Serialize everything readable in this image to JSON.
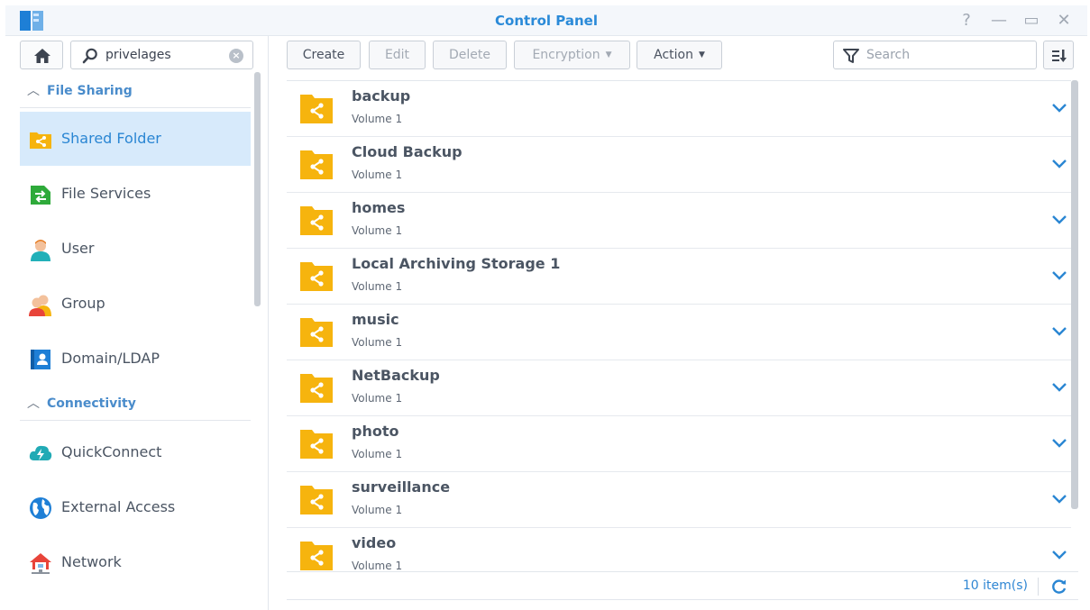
{
  "window": {
    "title": "Control Panel",
    "controls": {
      "help": "?",
      "minimize": "—",
      "maximize": "▭",
      "close": "✕"
    }
  },
  "sidebar": {
    "search_value": "privelages",
    "sections": [
      {
        "label": "File Sharing",
        "items": [
          {
            "label": "Shared Folder",
            "icon": "shared-folder-icon",
            "active": true
          },
          {
            "label": "File Services",
            "icon": "file-services-icon"
          },
          {
            "label": "User",
            "icon": "user-icon"
          },
          {
            "label": "Group",
            "icon": "group-icon"
          },
          {
            "label": "Domain/LDAP",
            "icon": "domain-ldap-icon"
          }
        ]
      },
      {
        "label": "Connectivity",
        "items": [
          {
            "label": "QuickConnect",
            "icon": "quickconnect-icon"
          },
          {
            "label": "External Access",
            "icon": "external-access-icon"
          },
          {
            "label": "Network",
            "icon": "network-icon"
          }
        ]
      }
    ]
  },
  "toolbar": {
    "create": "Create",
    "edit": "Edit",
    "delete": "Delete",
    "encryption": "Encryption",
    "action": "Action",
    "search_placeholder": "Search"
  },
  "folders": [
    {
      "name": "backup",
      "volume": "Volume 1"
    },
    {
      "name": "Cloud Backup",
      "volume": "Volume 1"
    },
    {
      "name": "homes",
      "volume": "Volume 1"
    },
    {
      "name": "Local Archiving Storage 1",
      "volume": "Volume 1"
    },
    {
      "name": "music",
      "volume": "Volume 1"
    },
    {
      "name": "NetBackup",
      "volume": "Volume 1"
    },
    {
      "name": "photo",
      "volume": "Volume 1"
    },
    {
      "name": "surveillance",
      "volume": "Volume 1"
    },
    {
      "name": "video",
      "volume": "Volume 1"
    }
  ],
  "footer": {
    "count": "10 item(s)"
  },
  "colors": {
    "accent": "#2a86d3",
    "folder": "#f6b40e",
    "active_bg": "#d7eafb"
  }
}
